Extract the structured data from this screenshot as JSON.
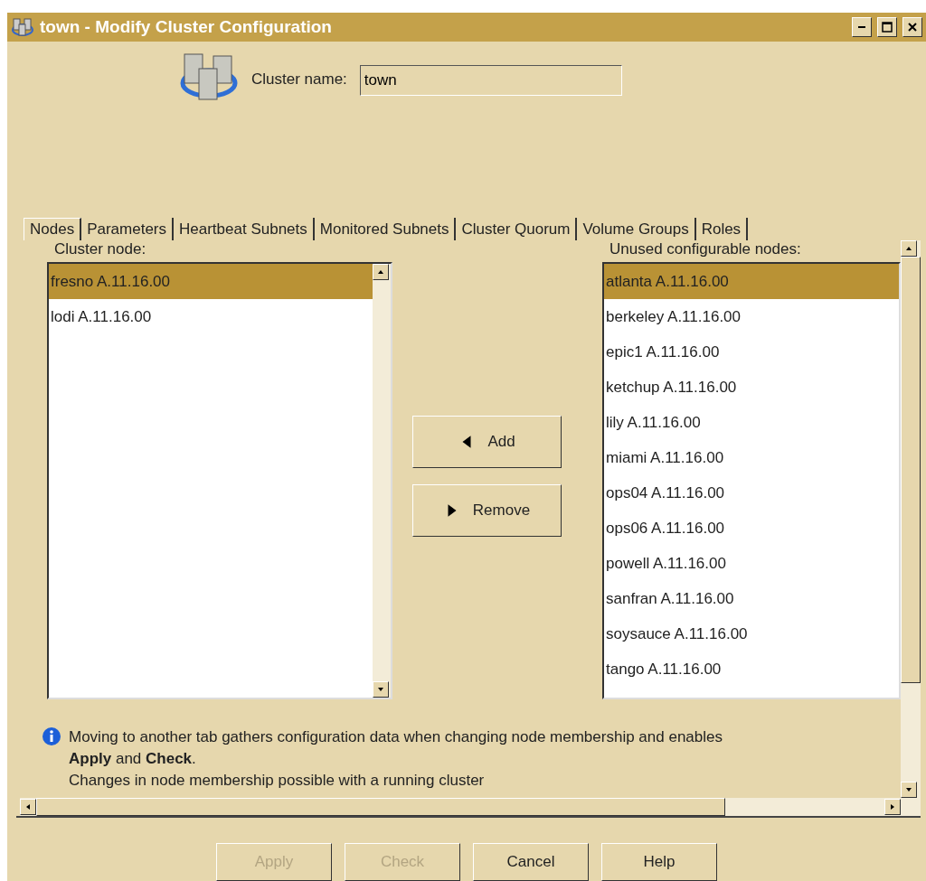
{
  "window": {
    "title": "town - Modify Cluster Configuration"
  },
  "cluster_name": {
    "label": "Cluster name:",
    "value": "town"
  },
  "tabs": [
    {
      "label": "Nodes",
      "selected": true
    },
    {
      "label": "Parameters",
      "selected": false
    },
    {
      "label": "Heartbeat Subnets",
      "selected": false
    },
    {
      "label": "Monitored Subnets",
      "selected": false
    },
    {
      "label": "Cluster Quorum",
      "selected": false
    },
    {
      "label": "Volume Groups",
      "selected": false
    },
    {
      "label": "Roles",
      "selected": false
    }
  ],
  "cluster_nodes": {
    "label": "Cluster node:",
    "items": [
      {
        "text": "fresno A.11.16.00",
        "selected": true
      },
      {
        "text": "lodi A.11.16.00",
        "selected": false
      }
    ]
  },
  "move_buttons": [
    {
      "kind": "add",
      "label": "Add"
    },
    {
      "kind": "remove",
      "label": "Remove"
    }
  ],
  "unused_nodes": {
    "label": "Unused configurable nodes:",
    "items": [
      {
        "text": "atlanta A.11.16.00",
        "selected": true
      },
      {
        "text": "berkeley A.11.16.00",
        "selected": false
      },
      {
        "text": "epic1 A.11.16.00",
        "selected": false
      },
      {
        "text": "ketchup A.11.16.00",
        "selected": false
      },
      {
        "text": "lily A.11.16.00",
        "selected": false
      },
      {
        "text": "miami A.11.16.00",
        "selected": false
      },
      {
        "text": "ops04 A.11.16.00",
        "selected": false
      },
      {
        "text": "ops06 A.11.16.00",
        "selected": false
      },
      {
        "text": "powell A.11.16.00",
        "selected": false
      },
      {
        "text": "sanfran A.11.16.00",
        "selected": false
      },
      {
        "text": "soysauce A.11.16.00",
        "selected": false
      },
      {
        "text": "tango A.11.16.00",
        "selected": false
      }
    ]
  },
  "info": [
    "Moving to another tab gathers configuration data when changing node membership and enables **Apply** and **Check**.",
    "Changes in node membership possible with a running cluster"
  ],
  "buttons": [
    {
      "label": "Apply",
      "disabled": true
    },
    {
      "label": "Check",
      "disabled": true
    },
    {
      "label": "Cancel",
      "disabled": false
    },
    {
      "label": "Help",
      "disabled": false
    }
  ]
}
